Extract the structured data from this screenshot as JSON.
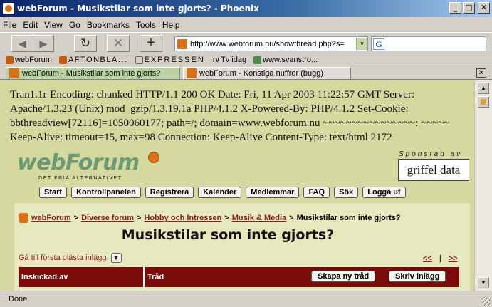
{
  "window": {
    "title": "webForum - Musikstilar som inte gjorts? - Phoenix",
    "minimize": "_",
    "maximize": "□",
    "close": "✕"
  },
  "menu": [
    "File",
    "Edit",
    "View",
    "Go",
    "Bookmarks",
    "Tools",
    "Help"
  ],
  "toolbar": {
    "back": "◀",
    "forward": "▶",
    "reload": "↻",
    "stop": "✕",
    "new_tab": "+",
    "url": "http://www.webforum.nu/showthread.php?s=",
    "search_icon_letter": "G",
    "search_value": ""
  },
  "bookmarks": [
    {
      "label": "webForum",
      "icon": "orange"
    },
    {
      "label": "AFTONBLA...",
      "icon": "orange"
    },
    {
      "label": "EXPRESSEN",
      "icon": "blue"
    },
    {
      "label": "Tv idag",
      "icon": "tv"
    },
    {
      "label": "www.svanstro...",
      "icon": "green"
    }
  ],
  "tabs": [
    {
      "label": "webForum - Musikstilar som inte gjorts?",
      "active": true
    },
    {
      "label": "webForum - Konstiga nuffror (bugg)",
      "active": false
    }
  ],
  "raw_header": "Tran1.1r-Encoding: chunked HTTP/1.1 200 OK Date: Fri, 11 Apr 2003 11:22:57 GMT Server: Apache/1.3.23 (Unix) mod_gzip/1.3.19.1a PHP/4.1.2 X-Powered-By: PHP/4.1.2 Set-Cookie: bbthreadview[72116]=1050060177; path=/; domain=www.webforum.nu ~~~~~~~~~~~~~~~~: ~~~~~ Keep-Alive: timeout=15, max=98 Connection: Keep-Alive Content-Type: text/html 2172",
  "logo": {
    "text": "webForum",
    "tagline": "DET FRIA ALTERNATIVET"
  },
  "sponsor": {
    "label": "Sponsrad av",
    "name": "griffel data"
  },
  "nav_buttons": [
    "Start",
    "Kontrollpanelen",
    "Registrera",
    "Kalender",
    "Medlemmar",
    "FAQ",
    "Sök",
    "Logga ut"
  ],
  "breadcrumb": {
    "items": [
      "webForum",
      "Diverse forum",
      "Hobby och Intressen",
      "Musik & Media"
    ],
    "current": "Musikstilar som inte gjorts?",
    "separator": ">"
  },
  "thread": {
    "title": "Musikstilar som inte gjorts?",
    "first_unread": "Gå till första olästa inlägg",
    "prev": "<<",
    "pager_sep": "|",
    "next": ">>"
  },
  "table": {
    "col_author": "Inskickad av",
    "col_thread": "Tråd",
    "new_thread": "Skapa ny tråd",
    "reply": "Skriv inlägg"
  },
  "status": {
    "text": "Done"
  }
}
